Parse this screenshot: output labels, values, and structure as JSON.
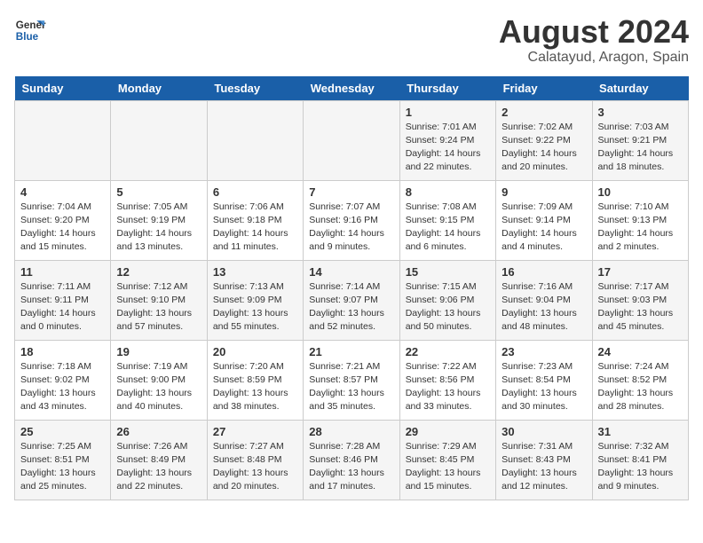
{
  "logo": {
    "line1": "General",
    "line2": "Blue"
  },
  "header": {
    "month": "August 2024",
    "location": "Calatayud, Aragon, Spain"
  },
  "weekdays": [
    "Sunday",
    "Monday",
    "Tuesday",
    "Wednesday",
    "Thursday",
    "Friday",
    "Saturday"
  ],
  "weeks": [
    [
      {
        "day": "",
        "info": ""
      },
      {
        "day": "",
        "info": ""
      },
      {
        "day": "",
        "info": ""
      },
      {
        "day": "",
        "info": ""
      },
      {
        "day": "1",
        "info": "Sunrise: 7:01 AM\nSunset: 9:24 PM\nDaylight: 14 hours\nand 22 minutes."
      },
      {
        "day": "2",
        "info": "Sunrise: 7:02 AM\nSunset: 9:22 PM\nDaylight: 14 hours\nand 20 minutes."
      },
      {
        "day": "3",
        "info": "Sunrise: 7:03 AM\nSunset: 9:21 PM\nDaylight: 14 hours\nand 18 minutes."
      }
    ],
    [
      {
        "day": "4",
        "info": "Sunrise: 7:04 AM\nSunset: 9:20 PM\nDaylight: 14 hours\nand 15 minutes."
      },
      {
        "day": "5",
        "info": "Sunrise: 7:05 AM\nSunset: 9:19 PM\nDaylight: 14 hours\nand 13 minutes."
      },
      {
        "day": "6",
        "info": "Sunrise: 7:06 AM\nSunset: 9:18 PM\nDaylight: 14 hours\nand 11 minutes."
      },
      {
        "day": "7",
        "info": "Sunrise: 7:07 AM\nSunset: 9:16 PM\nDaylight: 14 hours\nand 9 minutes."
      },
      {
        "day": "8",
        "info": "Sunrise: 7:08 AM\nSunset: 9:15 PM\nDaylight: 14 hours\nand 6 minutes."
      },
      {
        "day": "9",
        "info": "Sunrise: 7:09 AM\nSunset: 9:14 PM\nDaylight: 14 hours\nand 4 minutes."
      },
      {
        "day": "10",
        "info": "Sunrise: 7:10 AM\nSunset: 9:13 PM\nDaylight: 14 hours\nand 2 minutes."
      }
    ],
    [
      {
        "day": "11",
        "info": "Sunrise: 7:11 AM\nSunset: 9:11 PM\nDaylight: 14 hours\nand 0 minutes."
      },
      {
        "day": "12",
        "info": "Sunrise: 7:12 AM\nSunset: 9:10 PM\nDaylight: 13 hours\nand 57 minutes."
      },
      {
        "day": "13",
        "info": "Sunrise: 7:13 AM\nSunset: 9:09 PM\nDaylight: 13 hours\nand 55 minutes."
      },
      {
        "day": "14",
        "info": "Sunrise: 7:14 AM\nSunset: 9:07 PM\nDaylight: 13 hours\nand 52 minutes."
      },
      {
        "day": "15",
        "info": "Sunrise: 7:15 AM\nSunset: 9:06 PM\nDaylight: 13 hours\nand 50 minutes."
      },
      {
        "day": "16",
        "info": "Sunrise: 7:16 AM\nSunset: 9:04 PM\nDaylight: 13 hours\nand 48 minutes."
      },
      {
        "day": "17",
        "info": "Sunrise: 7:17 AM\nSunset: 9:03 PM\nDaylight: 13 hours\nand 45 minutes."
      }
    ],
    [
      {
        "day": "18",
        "info": "Sunrise: 7:18 AM\nSunset: 9:02 PM\nDaylight: 13 hours\nand 43 minutes."
      },
      {
        "day": "19",
        "info": "Sunrise: 7:19 AM\nSunset: 9:00 PM\nDaylight: 13 hours\nand 40 minutes."
      },
      {
        "day": "20",
        "info": "Sunrise: 7:20 AM\nSunset: 8:59 PM\nDaylight: 13 hours\nand 38 minutes."
      },
      {
        "day": "21",
        "info": "Sunrise: 7:21 AM\nSunset: 8:57 PM\nDaylight: 13 hours\nand 35 minutes."
      },
      {
        "day": "22",
        "info": "Sunrise: 7:22 AM\nSunset: 8:56 PM\nDaylight: 13 hours\nand 33 minutes."
      },
      {
        "day": "23",
        "info": "Sunrise: 7:23 AM\nSunset: 8:54 PM\nDaylight: 13 hours\nand 30 minutes."
      },
      {
        "day": "24",
        "info": "Sunrise: 7:24 AM\nSunset: 8:52 PM\nDaylight: 13 hours\nand 28 minutes."
      }
    ],
    [
      {
        "day": "25",
        "info": "Sunrise: 7:25 AM\nSunset: 8:51 PM\nDaylight: 13 hours\nand 25 minutes."
      },
      {
        "day": "26",
        "info": "Sunrise: 7:26 AM\nSunset: 8:49 PM\nDaylight: 13 hours\nand 22 minutes."
      },
      {
        "day": "27",
        "info": "Sunrise: 7:27 AM\nSunset: 8:48 PM\nDaylight: 13 hours\nand 20 minutes."
      },
      {
        "day": "28",
        "info": "Sunrise: 7:28 AM\nSunset: 8:46 PM\nDaylight: 13 hours\nand 17 minutes."
      },
      {
        "day": "29",
        "info": "Sunrise: 7:29 AM\nSunset: 8:45 PM\nDaylight: 13 hours\nand 15 minutes."
      },
      {
        "day": "30",
        "info": "Sunrise: 7:31 AM\nSunset: 8:43 PM\nDaylight: 13 hours\nand 12 minutes."
      },
      {
        "day": "31",
        "info": "Sunrise: 7:32 AM\nSunset: 8:41 PM\nDaylight: 13 hours\nand 9 minutes."
      }
    ]
  ]
}
